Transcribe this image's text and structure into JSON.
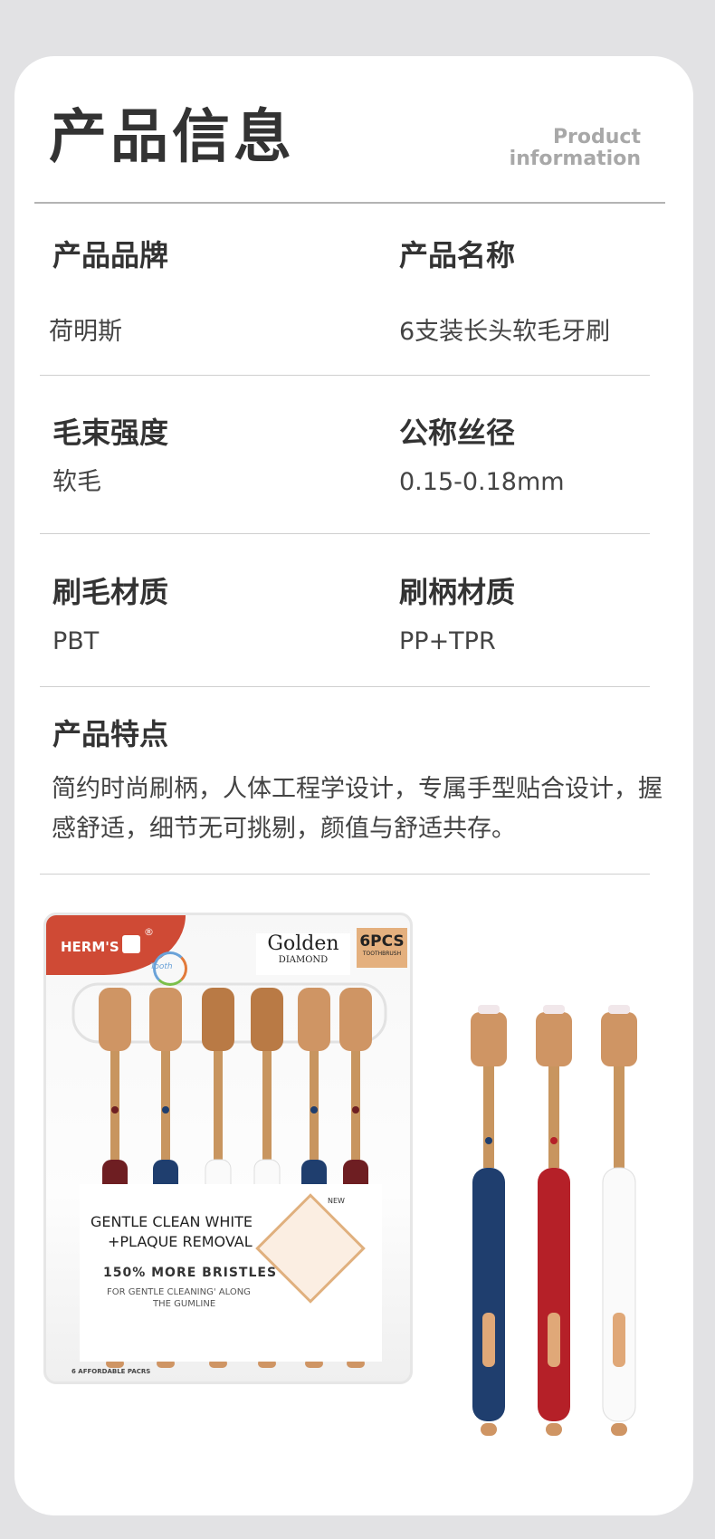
{
  "header": {
    "title": "产品信息",
    "title_en_line1": "Product",
    "title_en_line2": "information"
  },
  "info": {
    "brand_label": "产品品牌",
    "brand_value": "荷明斯",
    "name_label": "产品名称",
    "name_value": "6支装长头软毛牙刷",
    "strength_label": "毛束强度",
    "strength_value": "软毛",
    "diameter_label": "公称丝径",
    "diameter_value": "0.15-0.18mm",
    "bristle_label": "刷毛材质",
    "bristle_value": "PBT",
    "handle_label": "刷柄材质",
    "handle_value": "PP+TPR"
  },
  "features": {
    "label": "产品特点",
    "text": "简约时尚刷柄，人体工程学设计，专属手型贴合设计，握感舒适，细节无可挑剔，颜值与舒适共存。"
  },
  "package": {
    "brand": "HERM'S",
    "registered": "®",
    "sub_brand": "Tooth",
    "golden": "Golden",
    "diamond": "DIAMOND",
    "pcs": "6PCS",
    "pcs_sub": "TOOTHBRUSH",
    "line1": "GENTLE CLEAN WHITE",
    "line2": "+PLAQUE REMOVAL",
    "line3": "150% MORE BRISTLES'",
    "line4": "FOR GENTLE CLEANING' ALONG",
    "line5": "THE GUMLINE",
    "badge": "NEW",
    "footer": "6 AFFORDABLE PACRS"
  },
  "colors": {
    "gold": "#c8955f",
    "navy": "#1f3e6e",
    "red": "#b52028",
    "brand_red": "#cf4a35",
    "maroon": "#6e1e22"
  }
}
